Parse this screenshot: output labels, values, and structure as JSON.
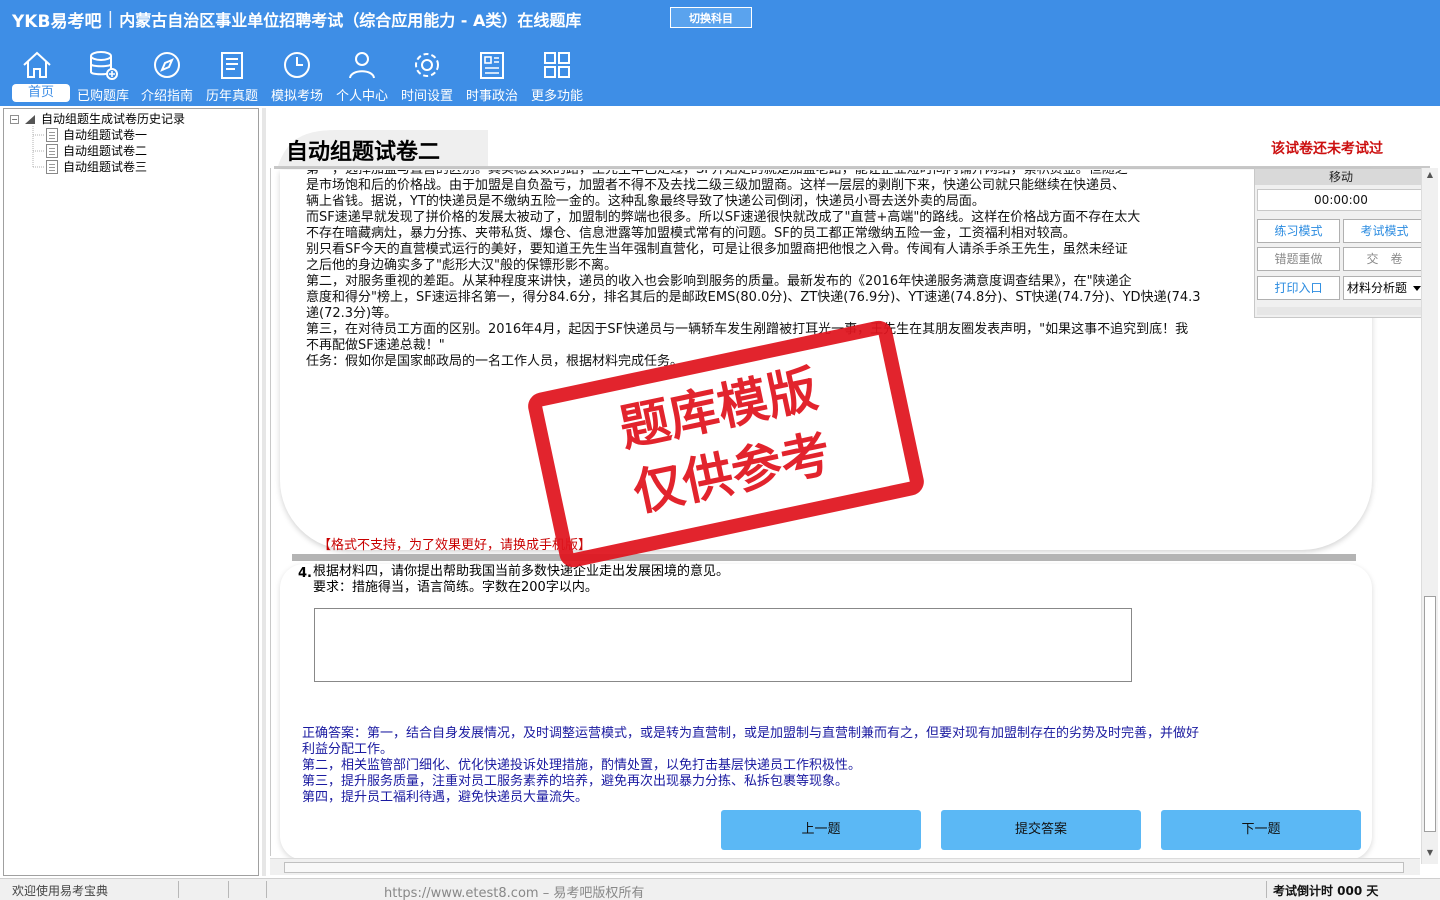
{
  "app": {
    "brand": "YKB易考吧",
    "title": "内蒙古自治区事业单位招聘考试（综合应用能力 - A类）在线题库",
    "switch_label": "切换科目"
  },
  "nav": [
    {
      "label": "首页",
      "icon": "home-icon"
    },
    {
      "label": "已购题库",
      "icon": "database-icon"
    },
    {
      "label": "介绍指南",
      "icon": "compass-icon"
    },
    {
      "label": "历年真题",
      "icon": "document-list-icon"
    },
    {
      "label": "模拟考场",
      "icon": "clock-icon"
    },
    {
      "label": "个人中心",
      "icon": "user-icon"
    },
    {
      "label": "时间设置",
      "icon": "gear-icon"
    },
    {
      "label": "时事政治",
      "icon": "newspaper-icon"
    },
    {
      "label": "更多功能",
      "icon": "grid-icon"
    }
  ],
  "tree": {
    "root": "自动组题生成试卷历史记录",
    "items": [
      "自动组题试卷一",
      "自动组题试卷二",
      "自动组题试卷三"
    ]
  },
  "paper": {
    "title": "自动组题试卷二",
    "status": "该试卷还未考试过"
  },
  "material": {
    "lines": [
      "第一，选择加盟与直营的区别。其实稳会数的路，王先生早已走过，SF开始走的就是加盟老路，能让企业短时间内铺开网络，累积资金。但随之",
      "是市场饱和后的价格战。由于加盟是自负盈亏，加盟者不得不及去找二级三级加盟商。这样一层层的剥削下来，快递公司就只能继续在快递员、",
      "辆上省钱。据说，YT的快递员是不缴纳五险一金的。这种乱象最终导致了快递公司倒闭，快递员小哥去送外卖的局面。",
      "而SF速递早就发现了拼价格的发展太被动了，加盟制的弊端也很多。所以SF速递很快就改成了\"直营+高端\"的路线。这样在价格战方面不存在太大",
      "不存在暗藏病灶，暴力分拣、夹带私货、爆仓、信息泄露等加盟模式常有的问题。SF的员工都正常缴纳五险一金，工资福利相对较高。",
      "别只看SF今天的直营模式运行的美好，要知道王先生当年强制直营化，可是让很多加盟商把他恨之入骨。传闻有人请杀手杀王先生，虽然未经证",
      "之后他的身边确实多了\"彪形大汉\"般的保镖形影不离。",
      "第二，对服务重视的差距。从某种程度来讲快，递员的收入也会影响到服务的质量。最新发布的《2016年快递服务满意度调查结果》，在\"陕递企",
      "意度和得分\"榜上，SF速运排名第一，得分84.6分，排名其后的是邮政EMS(80.0分)、ZT快递(76.9分)、YT速递(74.8分)、ST快递(74.7分)、YD快递(74.3",
      "递(72.3分)等。",
      "第三，在对待员工方面的区别。2016年4月，起因于SF快递员与一辆轿车发生剐蹭被打耳光一事，王先生在其朋友圈发表声明，\"如果这事不追究到底！我",
      "不再配做SF速递总裁！\"",
      "任务：假如你是国家邮政局的一名工作人员，根据材料完成任务。"
    ],
    "format_note": "【格式不支持，为了效果更好，请换成手机版】"
  },
  "control": {
    "move_label": "移动",
    "timer": "00:00:00",
    "practice_mode": "练习模式",
    "exam_mode": "考试模式",
    "redo_wrong": "错题重做",
    "submit_paper": "交　卷",
    "print_entry": "打印入口",
    "analysis_select": "材料分析题"
  },
  "question": {
    "number": "4.",
    "text": "根据材料四，请你提出帮助我国当前多数快递企业走出发展困境的意见。",
    "requirement": "要求：措施得当，语言简练。字数在200字以内。",
    "answer_value": "",
    "correct_answer": [
      "正确答案：第一，结合自身发展情况，及时调整运营模式，或是转为直营制，或是加盟制与直营制兼而有之，但要对现有加盟制存在的劣势及时完善，并做好",
      "利益分配工作。",
      "第二，相关监管部门细化、优化快递投诉处理措施，酌情处置，以免打击基层快递员工作积极性。",
      "第三，提升服务质量，注重对员工服务素养的培养，避免再次出现暴力分拣、私拆包裹等现象。",
      "第四，提升员工福利待遇，避免快递员大量流失。"
    ],
    "prev_label": "上一题",
    "submit_label": "提交答案",
    "next_label": "下一题"
  },
  "stamp": {
    "line1": "题库模版",
    "line2": "仅供参考"
  },
  "status": {
    "welcome": "欢迎使用易考宝典",
    "url": "https://www.etest8.com – 易考吧版权所有",
    "countdown": "考试倒计时 000 天"
  },
  "colors": {
    "brand_blue": "#3e8ee6",
    "button_blue": "#5bb8f5",
    "answer_blue": "#1a1aa0",
    "alert_red": "#cc1010",
    "stamp_red": "#e0141e"
  }
}
